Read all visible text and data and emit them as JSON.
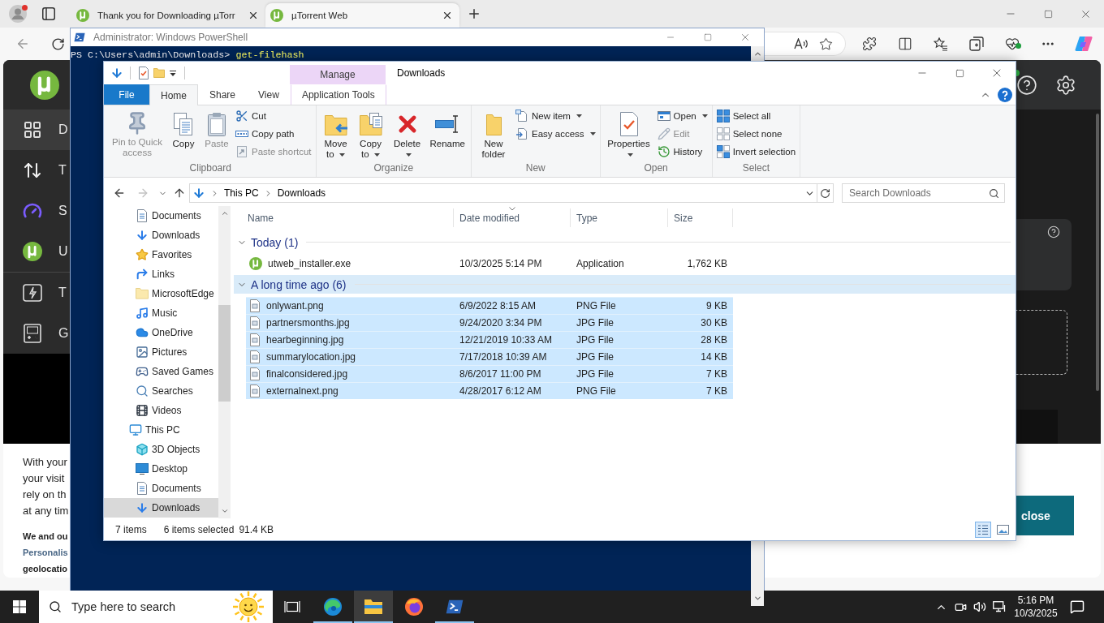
{
  "browser": {
    "tabs": [
      {
        "title": "Thank you for Downloading µTorr",
        "selected": false
      },
      {
        "title": "µTorrent Web",
        "selected": true
      }
    ],
    "page": {
      "sidebar": [
        {
          "label": "D",
          "selected": true
        },
        {
          "label": "T",
          "selected": false
        },
        {
          "label": "S",
          "selected": false
        },
        {
          "label": "U",
          "selected": false
        },
        {
          "label": "T",
          "selected": false
        },
        {
          "label": "G",
          "selected": false
        }
      ],
      "consent": {
        "lines": [
          "With your",
          "your visit",
          "rely on th",
          "at any tim"
        ],
        "notice": [
          {
            "text": "We and ou",
            "kind": "text"
          },
          {
            "text": "Personalis",
            "kind": "link"
          },
          {
            "text": "geolocatio",
            "kind": "text"
          }
        ],
        "close_button": "close"
      }
    }
  },
  "powershell": {
    "title": "Administrator: Windows PowerShell",
    "prompt": "PS C:\\Users\\admin\\Downloads>",
    "command": "get-filehash"
  },
  "explorer": {
    "title": "Downloads",
    "context_group": "Manage",
    "file_tab": "File",
    "tabs": [
      {
        "label": "Home",
        "selected": true,
        "kind": "standard"
      },
      {
        "label": "Share",
        "selected": false,
        "kind": "standard"
      },
      {
        "label": "View",
        "selected": false,
        "kind": "standard"
      },
      {
        "label": "Application Tools",
        "selected": false,
        "kind": "contextual"
      }
    ],
    "ribbon": [
      {
        "label": "Clipboard",
        "large": [
          {
            "label": "Pin to Quick access",
            "disabled": true,
            "dropdown": false
          },
          {
            "label": "Copy",
            "disabled": false,
            "dropdown": false
          },
          {
            "label": "Paste",
            "disabled": true,
            "dropdown": false
          }
        ],
        "small": [
          {
            "label": "Cut",
            "disabled": false,
            "dropdown": false
          },
          {
            "label": "Copy path",
            "disabled": false,
            "dropdown": false
          },
          {
            "label": "Paste shortcut",
            "disabled": true,
            "dropdown": false
          }
        ]
      },
      {
        "label": "Organize",
        "large": [
          {
            "label": "Move to",
            "disabled": false,
            "dropdown": true
          },
          {
            "label": "Copy to",
            "disabled": false,
            "dropdown": true
          },
          {
            "label": "Delete",
            "disabled": false,
            "dropdown": true
          },
          {
            "label": "Rename",
            "disabled": false,
            "dropdown": false
          }
        ]
      },
      {
        "label": "New",
        "large": [
          {
            "label": "New folder",
            "disabled": false,
            "dropdown": false
          }
        ],
        "small": [
          {
            "label": "New item",
            "disabled": false,
            "dropdown": true
          },
          {
            "label": "Easy access",
            "disabled": false,
            "dropdown": true
          }
        ]
      },
      {
        "label": "Open",
        "large": [
          {
            "label": "Properties",
            "disabled": false,
            "dropdown": true
          }
        ],
        "small": [
          {
            "label": "Open",
            "disabled": false,
            "dropdown": true
          },
          {
            "label": "Edit",
            "disabled": true,
            "dropdown": false
          },
          {
            "label": "History",
            "disabled": false,
            "dropdown": false
          }
        ]
      },
      {
        "label": "Select",
        "small": [
          {
            "label": "Select all",
            "disabled": false,
            "dropdown": false
          },
          {
            "label": "Select none",
            "disabled": false,
            "dropdown": false
          },
          {
            "label": "Invert selection",
            "disabled": false,
            "dropdown": false
          }
        ]
      }
    ],
    "address": {
      "path": [
        "This PC",
        "Downloads"
      ]
    },
    "search": {
      "placeholder": "Search Downloads"
    },
    "nav": [
      {
        "children": [
          {
            "label": "Documents",
            "selected": false
          },
          {
            "label": "Downloads",
            "selected": false
          },
          {
            "label": "Favorites",
            "selected": false
          },
          {
            "label": "Links",
            "selected": false
          },
          {
            "label": "MicrosoftEdge",
            "selected": false
          },
          {
            "label": "Music",
            "selected": false
          },
          {
            "label": "OneDrive",
            "selected": false
          },
          {
            "label": "Pictures",
            "selected": false
          },
          {
            "label": "Saved Games",
            "selected": false
          },
          {
            "label": "Searches",
            "selected": false
          },
          {
            "label": "Videos",
            "selected": false
          }
        ]
      },
      {
        "label": "This PC",
        "selected": false,
        "children": [
          {
            "label": "3D Objects",
            "selected": false
          },
          {
            "label": "Desktop",
            "selected": false
          },
          {
            "label": "Documents",
            "selected": false
          },
          {
            "label": "Downloads",
            "selected": true
          }
        ]
      }
    ],
    "columns": [
      {
        "label": "Name",
        "sorted": false
      },
      {
        "label": "Date modified",
        "sorted": true
      },
      {
        "label": "Type",
        "sorted": false
      },
      {
        "label": "Size",
        "sorted": false
      }
    ],
    "groups": [
      {
        "label": "Today (1)",
        "expanded": true,
        "selected": false,
        "files": [
          {
            "name": "utweb_installer.exe",
            "date": "10/3/2025 5:14 PM",
            "type": "Application",
            "size": "1,762 KB",
            "kind": "app",
            "selected": false
          }
        ]
      },
      {
        "label": "A long time ago (6)",
        "expanded": true,
        "selected": true,
        "files": [
          {
            "name": "onlywant.png",
            "date": "6/9/2022 8:15 AM",
            "type": "PNG File",
            "size": "9 KB",
            "kind": "image",
            "selected": true
          },
          {
            "name": "partnersmonths.jpg",
            "date": "9/24/2020 3:34 PM",
            "type": "JPG File",
            "size": "30 KB",
            "kind": "image",
            "selected": true
          },
          {
            "name": "hearbeginning.jpg",
            "date": "12/21/2019 10:33 AM",
            "type": "JPG File",
            "size": "28 KB",
            "kind": "image",
            "selected": true
          },
          {
            "name": "summarylocation.jpg",
            "date": "7/17/2018 10:39 AM",
            "type": "JPG File",
            "size": "14 KB",
            "kind": "image",
            "selected": true
          },
          {
            "name": "finalconsidered.jpg",
            "date": "8/6/2017 11:00 PM",
            "type": "JPG File",
            "size": "7 KB",
            "kind": "image",
            "selected": true
          },
          {
            "name": "externalnext.png",
            "date": "4/28/2017 6:12 AM",
            "type": "PNG File",
            "size": "7 KB",
            "kind": "image",
            "selected": true
          }
        ]
      }
    ],
    "status": {
      "count": "7 items",
      "selection": "6 items selected",
      "size": "91.4 KB"
    },
    "views": [
      {
        "selected": true
      },
      {
        "selected": false
      }
    ]
  },
  "taskbar": {
    "search": {
      "placeholder": "Type here to search"
    },
    "apps": [
      {
        "selected": false,
        "running": false
      },
      {
        "selected": false,
        "running": true
      },
      {
        "selected": true,
        "running": true
      },
      {
        "selected": false,
        "running": false
      },
      {
        "selected": false,
        "running": true
      }
    ],
    "time": "5:16 PM",
    "date": "10/3/2025"
  }
}
